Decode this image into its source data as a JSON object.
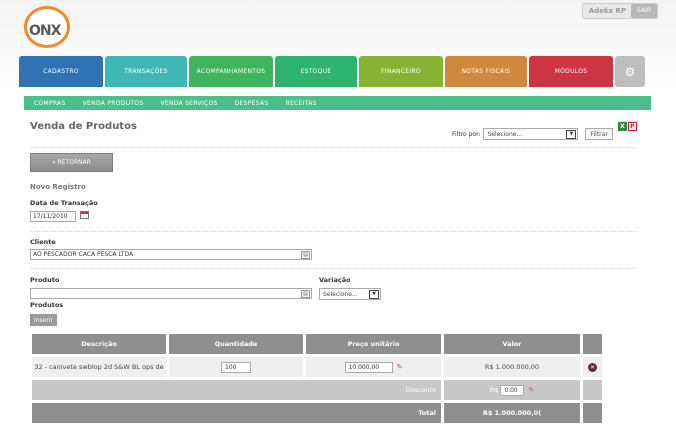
{
  "header": {
    "logo_text": "ONX",
    "user_name": "Adekx RP",
    "logout_label": "SAIR"
  },
  "main_nav": [
    {
      "label": "CADASTRO",
      "color": "#2f73b4"
    },
    {
      "label": "TRANSAÇÕES",
      "color": "#3fb8b5"
    },
    {
      "label": "ACOMPANHAMENTOS",
      "color": "#3fb65e"
    },
    {
      "label": "ESTOQUE",
      "color": "#2fb46f"
    },
    {
      "label": "FINANCEIRO",
      "color": "#86b432"
    },
    {
      "label": "NOTAS FISCAIS",
      "color": "#d0893c"
    },
    {
      "label": "MÓDULOS",
      "color": "#cc3544"
    }
  ],
  "sub_nav": [
    "COMPRAS",
    "VENDA PRODUTOS",
    "VENDA SERVIÇOS",
    "DESPESAS",
    "RECEITAS"
  ],
  "page": {
    "title": "Venda de Produtos",
    "filter_label": "Filtro por:",
    "filter_value": "Selecione...",
    "filter_button": "Filtrar",
    "back_button": "« RETORNAR",
    "section_title": "Novo Registro"
  },
  "form": {
    "date_label": "Data de Transação",
    "date_value": "17/11/2010",
    "client_label": "Cliente",
    "client_value": "AO PESCADOR CACA PESCA LTDA",
    "product_label": "Produto",
    "product_value": "",
    "variation_label": "Variação",
    "variation_value": "Selecione...",
    "products_label": "Produtos",
    "insert_button": "Inserir"
  },
  "table": {
    "headers": [
      "Descrição",
      "Quantidade",
      "Preço unitário",
      "Valor"
    ],
    "rows": [
      {
        "descricao": "32 - canivete swblop 2d S&W BL ops de",
        "quantidade": "100",
        "preco": "10.000,00",
        "valor": "R$ 1.000.000,00"
      }
    ],
    "discount_label": "Desconto",
    "discount_currency": "R$",
    "discount_value": "0,00",
    "total_label": "Total",
    "total_value": "R$ 1.000.000,0("
  }
}
